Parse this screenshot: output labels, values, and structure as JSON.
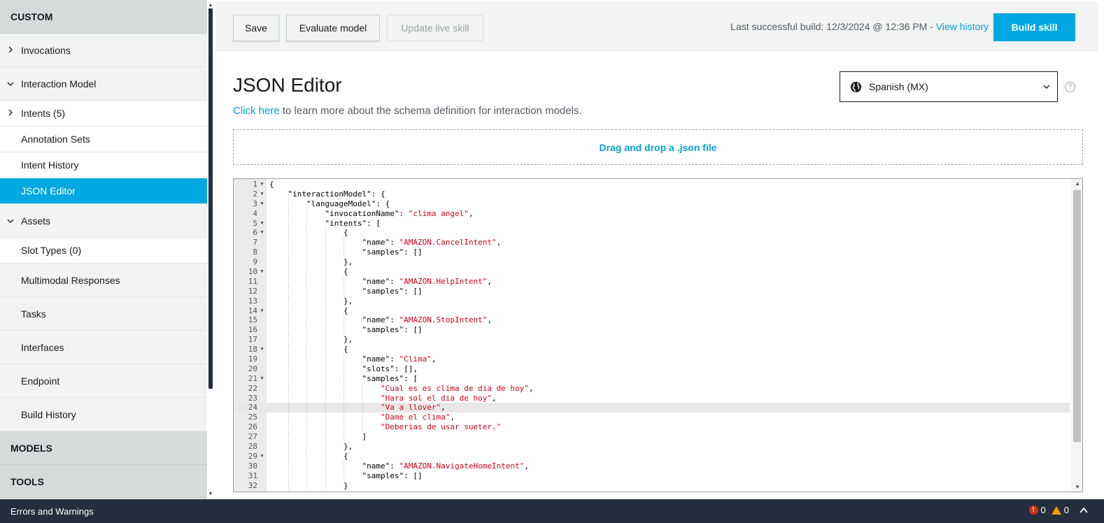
{
  "sidebar": {
    "custom_header": "CUSTOM",
    "invocations": "Invocations",
    "interaction_model": "Interaction Model",
    "intents": "Intents (5)",
    "annotation_sets": "Annotation Sets",
    "intent_history": "Intent History",
    "json_editor": "JSON Editor",
    "assets": "Assets",
    "slot_types": "Slot Types (0)",
    "multimodal": "Multimodal Responses",
    "tasks": "Tasks",
    "interfaces": "Interfaces",
    "endpoint": "Endpoint",
    "build_history": "Build History",
    "models_header": "MODELS",
    "tools_header": "TOOLS"
  },
  "toolbar": {
    "save": "Save",
    "evaluate": "Evaluate model",
    "update_live": "Update live skill",
    "last_build": "Last successful build: 12/3/2024 @ 12:36 PM -",
    "view_history": "View history",
    "build_skill": "Build skill"
  },
  "main": {
    "title": "JSON Editor",
    "help_link": "Click here",
    "help_text": " to learn more about the schema definition for interaction models.",
    "locale": "Spanish (MX)",
    "dropzone": "Drag and drop a .json file"
  },
  "editor": {
    "highlight_line": 24,
    "lines": [
      {
        "n": "1",
        "fold": true,
        "indent": 0,
        "parts": [
          [
            "p",
            "{"
          ]
        ]
      },
      {
        "n": "2",
        "fold": true,
        "indent": 1,
        "parts": [
          [
            "p",
            "\"interactionModel\": {"
          ]
        ]
      },
      {
        "n": "3",
        "fold": true,
        "indent": 2,
        "parts": [
          [
            "p",
            "\"languageModel\": {"
          ]
        ]
      },
      {
        "n": "4",
        "fold": false,
        "indent": 3,
        "parts": [
          [
            "p",
            "\"invocationName\": "
          ],
          [
            "s",
            "\"clima angel\""
          ],
          [
            "p",
            ","
          ]
        ]
      },
      {
        "n": "5",
        "fold": true,
        "indent": 3,
        "parts": [
          [
            "p",
            "\"intents\": ["
          ]
        ]
      },
      {
        "n": "6",
        "fold": true,
        "indent": 4,
        "parts": [
          [
            "p",
            "{"
          ]
        ]
      },
      {
        "n": "7",
        "fold": false,
        "indent": 5,
        "parts": [
          [
            "p",
            "\"name\": "
          ],
          [
            "s",
            "\"AMAZON.CancelIntent\""
          ],
          [
            "p",
            ","
          ]
        ]
      },
      {
        "n": "8",
        "fold": false,
        "indent": 5,
        "parts": [
          [
            "p",
            "\"samples\": []"
          ]
        ]
      },
      {
        "n": "9",
        "fold": false,
        "indent": 4,
        "parts": [
          [
            "p",
            "},"
          ]
        ]
      },
      {
        "n": "10",
        "fold": true,
        "indent": 4,
        "parts": [
          [
            "p",
            "{"
          ]
        ]
      },
      {
        "n": "11",
        "fold": false,
        "indent": 5,
        "parts": [
          [
            "p",
            "\"name\": "
          ],
          [
            "s",
            "\"AMAZON.HelpIntent\""
          ],
          [
            "p",
            ","
          ]
        ]
      },
      {
        "n": "12",
        "fold": false,
        "indent": 5,
        "parts": [
          [
            "p",
            "\"samples\": []"
          ]
        ]
      },
      {
        "n": "13",
        "fold": false,
        "indent": 4,
        "parts": [
          [
            "p",
            "},"
          ]
        ]
      },
      {
        "n": "14",
        "fold": true,
        "indent": 4,
        "parts": [
          [
            "p",
            "{"
          ]
        ]
      },
      {
        "n": "15",
        "fold": false,
        "indent": 5,
        "parts": [
          [
            "p",
            "\"name\": "
          ],
          [
            "s",
            "\"AMAZON.StopIntent\""
          ],
          [
            "p",
            ","
          ]
        ]
      },
      {
        "n": "16",
        "fold": false,
        "indent": 5,
        "parts": [
          [
            "p",
            "\"samples\": []"
          ]
        ]
      },
      {
        "n": "17",
        "fold": false,
        "indent": 4,
        "parts": [
          [
            "p",
            "},"
          ]
        ]
      },
      {
        "n": "18",
        "fold": true,
        "indent": 4,
        "parts": [
          [
            "p",
            "{"
          ]
        ]
      },
      {
        "n": "19",
        "fold": false,
        "indent": 5,
        "parts": [
          [
            "p",
            "\"name\": "
          ],
          [
            "s",
            "\"Clima\""
          ],
          [
            "p",
            ","
          ]
        ]
      },
      {
        "n": "20",
        "fold": false,
        "indent": 5,
        "parts": [
          [
            "p",
            "\"slots\": [],"
          ]
        ]
      },
      {
        "n": "21",
        "fold": true,
        "indent": 5,
        "parts": [
          [
            "p",
            "\"samples\": ["
          ]
        ]
      },
      {
        "n": "22",
        "fold": false,
        "indent": 6,
        "parts": [
          [
            "s",
            "\"Cual es es clima de dia de hoy\""
          ],
          [
            "p",
            ","
          ]
        ]
      },
      {
        "n": "23",
        "fold": false,
        "indent": 6,
        "parts": [
          [
            "s",
            "\"Hara sol el dia de hoy\""
          ],
          [
            "p",
            ","
          ]
        ]
      },
      {
        "n": "24",
        "fold": false,
        "indent": 6,
        "parts": [
          [
            "s",
            "\"Va a llover\""
          ],
          [
            "p",
            ","
          ]
        ]
      },
      {
        "n": "25",
        "fold": false,
        "indent": 6,
        "parts": [
          [
            "s",
            "\"Dame el clima\""
          ],
          [
            "p",
            ","
          ]
        ]
      },
      {
        "n": "26",
        "fold": false,
        "indent": 6,
        "parts": [
          [
            "s",
            "\"Deberias de usar sueter.\""
          ]
        ]
      },
      {
        "n": "27",
        "fold": false,
        "indent": 5,
        "parts": [
          [
            "p",
            "]"
          ]
        ]
      },
      {
        "n": "28",
        "fold": false,
        "indent": 4,
        "parts": [
          [
            "p",
            "},"
          ]
        ]
      },
      {
        "n": "29",
        "fold": true,
        "indent": 4,
        "parts": [
          [
            "p",
            "{"
          ]
        ]
      },
      {
        "n": "30",
        "fold": false,
        "indent": 5,
        "parts": [
          [
            "p",
            "\"name\": "
          ],
          [
            "s",
            "\"AMAZON.NavigateHomeIntent\""
          ],
          [
            "p",
            ","
          ]
        ]
      },
      {
        "n": "31",
        "fold": false,
        "indent": 5,
        "parts": [
          [
            "p",
            "\"samples\": []"
          ]
        ]
      },
      {
        "n": "32",
        "fold": false,
        "indent": 4,
        "parts": [
          [
            "p",
            "}"
          ]
        ]
      }
    ]
  },
  "footer": {
    "label": "Errors and Warnings",
    "errors": "0",
    "warnings": "0"
  }
}
